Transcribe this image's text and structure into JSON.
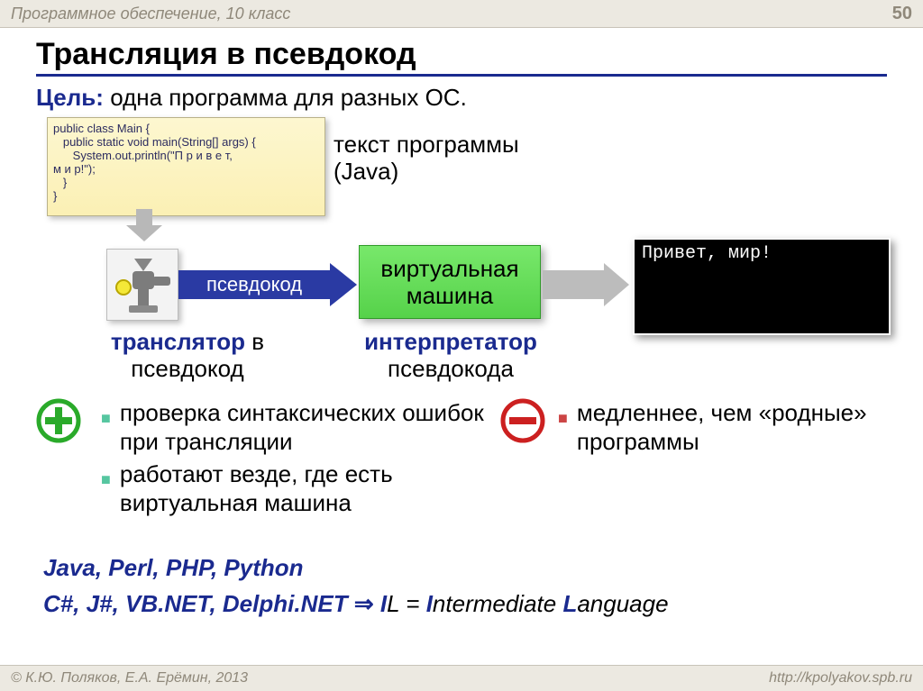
{
  "header": {
    "subject": "Программное обеспечение, 10 класс",
    "page_number": "50"
  },
  "title": "Трансляция в псевдокод",
  "goal": {
    "label": "Цель",
    "text": "одна программа для разных ОС."
  },
  "code_box": "public class Main {\n   public static void main(String[] args) {\n      System.out.println(\"П р и в е т,\nм и р!\");\n   }\n}",
  "source_label": "текст программы\n(Java)",
  "arrow_label": "псевдокод",
  "vm_label": "виртуальная\nмашина",
  "console_output": "Привет, мир!",
  "translator_caption": {
    "bold": "транслятор",
    "rest": " в",
    "line2": "псевдокод"
  },
  "interpreter_caption": {
    "bold": "интерпретатор",
    "line2": "псевдокода"
  },
  "pros": [
    "проверка синтаксических ошибок при трансляции",
    "работают везде, где есть виртуальная машина"
  ],
  "cons": [
    "медленнее, чем «родные» программы"
  ],
  "langs_line1": "Java, Perl, PHP, Python",
  "langs_line2_prefix": "C#, J#, VB.NET, Delphi.NET ",
  "langs_arrow": "⇒",
  "langs_il_bold1": " I",
  "langs_il_rest1": "L = ",
  "langs_il_bold2": "I",
  "langs_il_rest2": "ntermediate ",
  "langs_il_bold3": "L",
  "langs_il_rest3": "anguage",
  "footer": {
    "left": "© К.Ю. Поляков, Е.А. Ерёмин, 2013",
    "right": "http://kpolyakov.spb.ru"
  }
}
